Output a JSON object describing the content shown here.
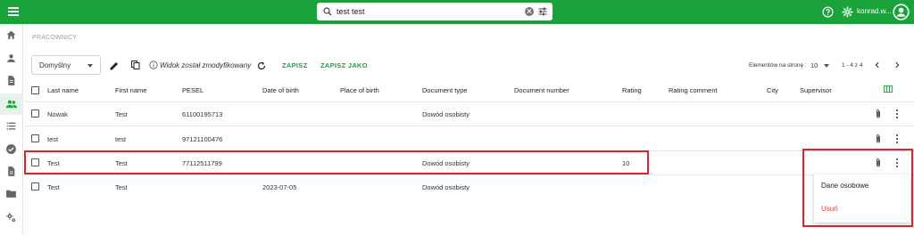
{
  "search": {
    "value": "test test"
  },
  "user": {
    "name": "konrad.w..."
  },
  "breadcrumb": "PRACOWNICY",
  "toolbar": {
    "view": "Domyślny",
    "modified": "Widok został zmodyfikowany",
    "save": "ZAPISZ",
    "save_as": "ZAPISZ JAKO"
  },
  "pager": {
    "label": "Elementów na stronę :",
    "size": "10",
    "range": "1 - 4 z 4"
  },
  "columns": [
    "Last name",
    "First name",
    "PESEL",
    "Date of birth",
    "Place of birth",
    "Document type",
    "Document number",
    "Rating",
    "Rating comment",
    "City",
    "Supervisor"
  ],
  "rows": [
    {
      "last": "Nowak",
      "first": "Test",
      "pesel": "61100195713",
      "dob": "",
      "pob": "",
      "doctype": "Dowód osobisty",
      "docno": "",
      "rating": "",
      "comment": "",
      "city": "",
      "supervisor": ""
    },
    {
      "last": "test",
      "first": "test",
      "pesel": "97121100476",
      "dob": "",
      "pob": "",
      "doctype": "",
      "docno": "",
      "rating": "",
      "comment": "",
      "city": "",
      "supervisor": ""
    },
    {
      "last": "Test",
      "first": "Test",
      "pesel": "77112511799",
      "dob": "",
      "pob": "",
      "doctype": "Dowód osobisty",
      "docno": "",
      "rating": "10",
      "comment": "",
      "city": "",
      "supervisor": ""
    },
    {
      "last": "Test",
      "first": "Test",
      "pesel": "",
      "dob": "2023-07-05",
      "pob": "",
      "doctype": "Dowód osobisty",
      "docno": "",
      "rating": "",
      "comment": "",
      "city": "",
      "supervisor": ""
    }
  ],
  "menu": {
    "personal": "Dane osobowe",
    "delete": "Usuń"
  },
  "colors": {
    "brand": "#1aa33a",
    "highlight": "#e0202d",
    "danger": "#e53935"
  },
  "icons": [
    "menu-icon",
    "search-icon",
    "clear-icon",
    "tune-icon",
    "help-icon",
    "gear-icon",
    "avatar-icon",
    "home-icon",
    "person-icon",
    "document-icon",
    "people-icon",
    "list-icon",
    "check-icon",
    "file-icon",
    "folder-icon",
    "settings-icon",
    "edit-icon",
    "copy-icon",
    "info-icon",
    "refresh-icon",
    "chevron-left-icon",
    "chevron-right-icon",
    "columns-icon",
    "attachment-icon",
    "more-vert-icon"
  ]
}
